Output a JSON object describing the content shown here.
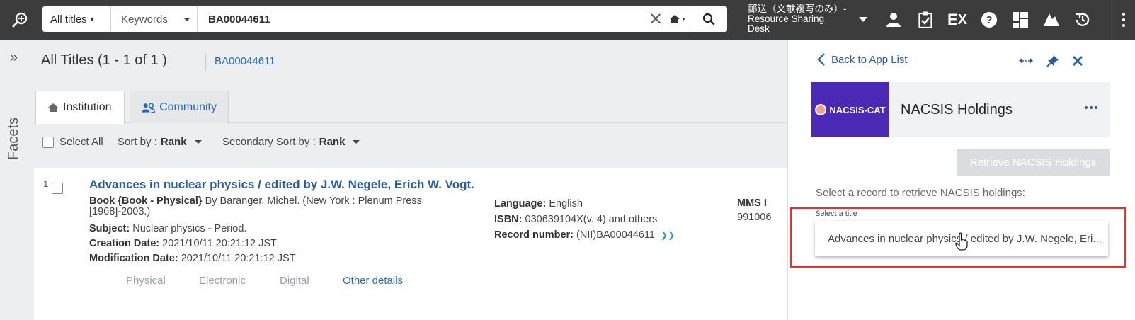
{
  "topbar": {
    "scope_label": "All titles",
    "field_label": "Keywords",
    "query": "BA00044611",
    "clear_symbol": "✕",
    "institution": "郵送（文献複写のみ）- Resource Sharing Desk",
    "icons": [
      "advanced-search-icon",
      "home-icon",
      "search-icon",
      "user-icon",
      "tasks-icon",
      "ex-icon",
      "help-icon",
      "widgets-icon",
      "leganto-icon",
      "history-icon",
      "menu-icon"
    ]
  },
  "facets": {
    "label": "Facets",
    "toggle": "»"
  },
  "results": {
    "title": "All Titles (1 - 1 of 1 )",
    "query_chip": "BA00044611",
    "tabs": [
      "Institution",
      "Community"
    ],
    "select_all": "Select All",
    "sort_label": "Sort by :",
    "sort_value": "Rank",
    "secondary_sort_label": "Secondary Sort by :",
    "secondary_sort_value": "Rank"
  },
  "record": {
    "number": "1",
    "title": "Advances in nuclear physics / edited by J.W. Negele, Erich W. Vogt.",
    "type": "Book {Book - Physical}",
    "author_line": "By Baranger, Michel. (New York : Plenum Press [1968]-2003.)",
    "subject_label": "Subject:",
    "subject": "Nuclear physics - Period.",
    "creation_label": "Creation Date:",
    "creation": "2021/10/11 20:21:12 JST",
    "modification_label": "Modification Date:",
    "modification": "2021/10/11 20:21:12 JST",
    "language_label": "Language:",
    "language": "English",
    "isbn_label": "ISBN:",
    "isbn": "030639104X(v. 4) and others",
    "recnum_label": "Record number:",
    "recnum": "(NII)BA00044611",
    "mms_label": "MMS I",
    "mms_value": "991006",
    "tabs": [
      "Physical",
      "Electronic",
      "Digital",
      "Other details"
    ]
  },
  "panel": {
    "back_label": "Back to App List",
    "logo_text": "NACSIS-CAT",
    "app_name": "NACSIS Holdings",
    "retrieve_button": "Retrieve NACSIS Holdings",
    "instruction": "Select a record to retrieve NACSIS holdings:",
    "select_label": "Select a title",
    "select_value": "Advances in nuclear physics / edited by J.W. Negele, Eri...",
    "highlight_color": "#e2332e",
    "brand_color": "#4a2ab5"
  }
}
